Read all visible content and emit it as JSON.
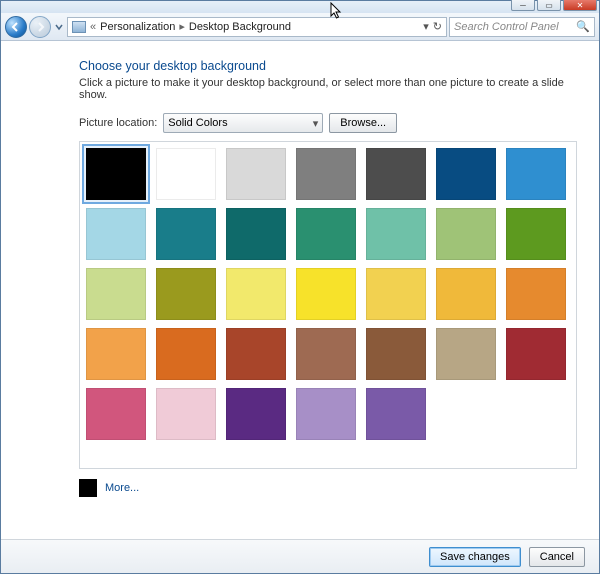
{
  "window": {
    "min": "–",
    "max": "▢",
    "close": "✕"
  },
  "breadcrumb": {
    "level1": "Personalization",
    "level2": "Desktop Background"
  },
  "search": {
    "placeholder": "Search Control Panel"
  },
  "heading": "Choose your desktop background",
  "subtext": "Click a picture to make it your desktop background, or select more than one picture to create a slide show.",
  "picture_location_label": "Picture location:",
  "picture_location_value": "Solid Colors",
  "browse_label": "Browse...",
  "more_label": "More...",
  "footer": {
    "save": "Save changes",
    "cancel": "Cancel"
  },
  "colors": [
    {
      "hex": "#000000",
      "selected": true
    },
    {
      "hex": "#ffffff"
    },
    {
      "hex": "#d9d9d9"
    },
    {
      "hex": "#7f7f7f"
    },
    {
      "hex": "#4d4d4d"
    },
    {
      "hex": "#084c82"
    },
    {
      "hex": "#2f8fd0"
    },
    {
      "hex": "#a4d7e6"
    },
    {
      "hex": "#197d8a"
    },
    {
      "hex": "#0f6a6a"
    },
    {
      "hex": "#2a9070"
    },
    {
      "hex": "#6fc1a8"
    },
    {
      "hex": "#9fc377"
    },
    {
      "hex": "#5d9a1f"
    },
    {
      "hex": "#c9dc8f"
    },
    {
      "hex": "#9a9a1e"
    },
    {
      "hex": "#f2e96c"
    },
    {
      "hex": "#f7e22a"
    },
    {
      "hex": "#f2d150"
    },
    {
      "hex": "#f0b93a"
    },
    {
      "hex": "#e68a2e"
    },
    {
      "hex": "#f2a24a"
    },
    {
      "hex": "#d96b1f"
    },
    {
      "hex": "#a8452a"
    },
    {
      "hex": "#9e6a52"
    },
    {
      "hex": "#8a5a3a"
    },
    {
      "hex": "#b7a685"
    },
    {
      "hex": "#a02b33"
    },
    {
      "hex": "#d1567d"
    },
    {
      "hex": "#f0cbd7"
    },
    {
      "hex": "#5a2a82"
    },
    {
      "hex": "#a78fc7"
    },
    {
      "hex": "#7a5aa8"
    }
  ]
}
